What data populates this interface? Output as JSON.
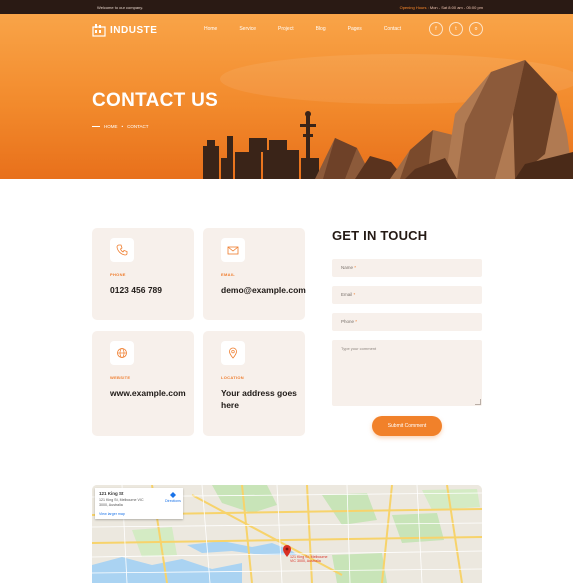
{
  "topbar": {
    "welcome": "Welcome to our company.",
    "hours_label": "Opening Hours :",
    "hours_value": "Mon - Sat 8:00 am - 05:00 pm"
  },
  "brand": {
    "name": "INDUSTE"
  },
  "nav": [
    "Home",
    "Service",
    "Project",
    "Blog",
    "Pages",
    "Contact"
  ],
  "social": [
    {
      "icon": "facebook-icon",
      "glyph": "f"
    },
    {
      "icon": "twitter-icon",
      "glyph": "t"
    },
    {
      "icon": "instagram-icon",
      "glyph": "o"
    }
  ],
  "hero": {
    "title": "CONTACT US",
    "breadcrumb": {
      "home": "HOME",
      "sep": "•",
      "current": "CONTACT"
    }
  },
  "cards": [
    {
      "label": "PHONE",
      "value": "0123 456 789",
      "icon": "phone-icon"
    },
    {
      "label": "EMAIL",
      "value": "demo@example.com",
      "icon": "mail-icon"
    },
    {
      "label": "WEBSITE",
      "value": "www.example.com",
      "icon": "globe-icon"
    },
    {
      "label": "LOCATION",
      "value": "Your address goes here",
      "icon": "location-pin-icon"
    }
  ],
  "form": {
    "title": "GET IN TOUCH",
    "name_placeholder": "Name",
    "email_placeholder": "Email",
    "phone_placeholder": "Phone",
    "comment_placeholder": "Type your comment",
    "required_mark": "*",
    "submit_label": "Submit Comment"
  },
  "map": {
    "place_title": "121 King St",
    "place_address": "121 King St, Melbourne VIC 3000, Australia",
    "larger_map": "View larger map",
    "directions": "Directions",
    "pin_label": "121 King St, Melbourne VIC 3000, Australia"
  },
  "colors": {
    "accent": "#f1812a",
    "topbar_bg": "#2a1a14",
    "card_bg": "#f7f0eb",
    "hero_top": "#f9a448",
    "hero_bottom": "#e8701b"
  }
}
